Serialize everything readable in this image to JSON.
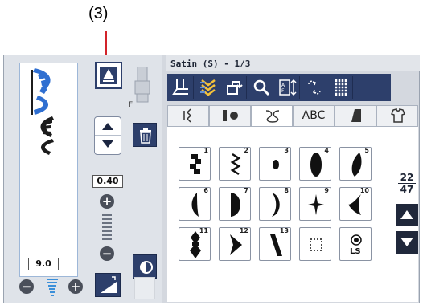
{
  "callout": {
    "label": "(3)"
  },
  "header": {
    "title": "Satin (S) - 1/3"
  },
  "tabs": [
    {
      "label": "",
      "icon": "straight-stitch-icon"
    },
    {
      "label": "",
      "icon": "buttonhole-icon"
    },
    {
      "label": "",
      "icon": "decorative-stitch-icon",
      "active": true
    },
    {
      "label": "ABC",
      "icon": ""
    },
    {
      "label": "",
      "icon": "quilt-icon"
    },
    {
      "label": "",
      "icon": "shirt-icon"
    }
  ],
  "toolbar": {
    "tools": [
      "presser-foot-icon",
      "cross-stitch-icon",
      "back-icon",
      "search-icon",
      "letter-size-icon",
      "flip-icon",
      "pattern-grid-icon"
    ]
  },
  "left_panel": {
    "foot_label": "F",
    "width_value": "0.40",
    "length_value": "9.0"
  },
  "stitches": [
    {
      "num": "1"
    },
    {
      "num": "2"
    },
    {
      "num": "3"
    },
    {
      "num": "4"
    },
    {
      "num": "5"
    },
    {
      "num": "6"
    },
    {
      "num": "7"
    },
    {
      "num": "8"
    },
    {
      "num": "9"
    },
    {
      "num": "10"
    },
    {
      "num": "11"
    },
    {
      "num": "12"
    },
    {
      "num": "13"
    },
    {
      "num": ""
    },
    {
      "num": ""
    }
  ],
  "ls_label": "LS",
  "pagination": {
    "current": "22",
    "total": "47"
  },
  "colors": {
    "accent": "#2d3f6b",
    "callout_line": "#d2232a"
  }
}
